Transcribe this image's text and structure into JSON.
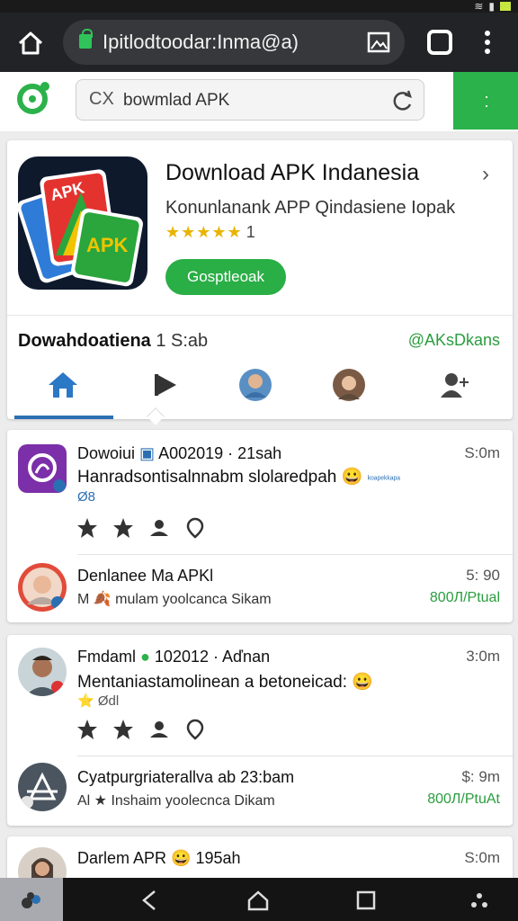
{
  "browser": {
    "url": "Ipitlodtoodar:Inma@a)"
  },
  "search": {
    "clear_glyph": "CX",
    "query": "bowmlad APK"
  },
  "app": {
    "title": "Download APK Indanesia",
    "subtitle": "Konunlanank APP Qindasiene Iopak",
    "rating_stars": "★★★★★",
    "rating_count": "1",
    "download_label": "Gosptleoak",
    "developer_name": "Dowahdoatiena",
    "developer_meta": "1 S:ab",
    "developer_handle": "@AKsDkans",
    "nav_icons": [
      "home-icon",
      "play-icon",
      "avatar-1",
      "avatar-2",
      "people-icon"
    ]
  },
  "feed": [
    {
      "title": "Dowoiui",
      "date": "A002019 · 21sah",
      "time": "S:0m",
      "body": "Hanradsontisalnnabm slolaredpah 😀",
      "body_small": "ᵏᵒᵃᵖᵉᵏᵏᵃᵖᵃ",
      "tag": "Ø8",
      "reply_title": "Denlanee Ma APKl",
      "reply_time": "5: 90",
      "reply_meta": "M 🍂 mulam yoolcanca Sikam",
      "reply_link": "800Л/Ptual"
    },
    {
      "title": "Fmdaml",
      "date": "102012 · Aďnan",
      "time": "3:0m",
      "body": "Mentaniastamolinean a betoneicad: 😀",
      "tag": "⭐ Ødl",
      "reply_title": "Cyatpurgriaterallva ab 23:bam",
      "reply_time": "$: 9m",
      "reply_meta": "Al ★ Inshaim yoolecnca Dikam",
      "reply_link": "800Л/PtuAt"
    },
    {
      "title": "Darlem APR 😀",
      "date": "195ah",
      "time": "S:0m"
    }
  ],
  "colors": {
    "accent_green": "#2bb24a",
    "link_blue": "#2b6fb3",
    "star_gold": "#e8b400"
  }
}
